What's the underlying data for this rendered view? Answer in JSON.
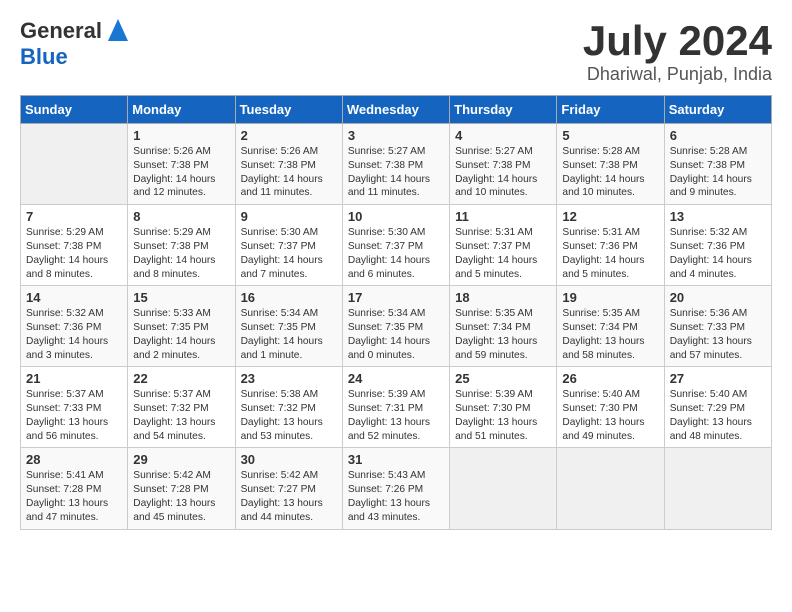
{
  "header": {
    "logo_general": "General",
    "logo_blue": "Blue",
    "month": "July 2024",
    "location": "Dhariwal, Punjab, India"
  },
  "weekdays": [
    "Sunday",
    "Monday",
    "Tuesday",
    "Wednesday",
    "Thursday",
    "Friday",
    "Saturday"
  ],
  "weeks": [
    [
      {
        "day": "",
        "info": ""
      },
      {
        "day": "1",
        "info": "Sunrise: 5:26 AM\nSunset: 7:38 PM\nDaylight: 14 hours\nand 12 minutes."
      },
      {
        "day": "2",
        "info": "Sunrise: 5:26 AM\nSunset: 7:38 PM\nDaylight: 14 hours\nand 11 minutes."
      },
      {
        "day": "3",
        "info": "Sunrise: 5:27 AM\nSunset: 7:38 PM\nDaylight: 14 hours\nand 11 minutes."
      },
      {
        "day": "4",
        "info": "Sunrise: 5:27 AM\nSunset: 7:38 PM\nDaylight: 14 hours\nand 10 minutes."
      },
      {
        "day": "5",
        "info": "Sunrise: 5:28 AM\nSunset: 7:38 PM\nDaylight: 14 hours\nand 10 minutes."
      },
      {
        "day": "6",
        "info": "Sunrise: 5:28 AM\nSunset: 7:38 PM\nDaylight: 14 hours\nand 9 minutes."
      }
    ],
    [
      {
        "day": "7",
        "info": "Sunrise: 5:29 AM\nSunset: 7:38 PM\nDaylight: 14 hours\nand 8 minutes."
      },
      {
        "day": "8",
        "info": "Sunrise: 5:29 AM\nSunset: 7:38 PM\nDaylight: 14 hours\nand 8 minutes."
      },
      {
        "day": "9",
        "info": "Sunrise: 5:30 AM\nSunset: 7:37 PM\nDaylight: 14 hours\nand 7 minutes."
      },
      {
        "day": "10",
        "info": "Sunrise: 5:30 AM\nSunset: 7:37 PM\nDaylight: 14 hours\nand 6 minutes."
      },
      {
        "day": "11",
        "info": "Sunrise: 5:31 AM\nSunset: 7:37 PM\nDaylight: 14 hours\nand 5 minutes."
      },
      {
        "day": "12",
        "info": "Sunrise: 5:31 AM\nSunset: 7:36 PM\nDaylight: 14 hours\nand 5 minutes."
      },
      {
        "day": "13",
        "info": "Sunrise: 5:32 AM\nSunset: 7:36 PM\nDaylight: 14 hours\nand 4 minutes."
      }
    ],
    [
      {
        "day": "14",
        "info": "Sunrise: 5:32 AM\nSunset: 7:36 PM\nDaylight: 14 hours\nand 3 minutes."
      },
      {
        "day": "15",
        "info": "Sunrise: 5:33 AM\nSunset: 7:35 PM\nDaylight: 14 hours\nand 2 minutes."
      },
      {
        "day": "16",
        "info": "Sunrise: 5:34 AM\nSunset: 7:35 PM\nDaylight: 14 hours\nand 1 minute."
      },
      {
        "day": "17",
        "info": "Sunrise: 5:34 AM\nSunset: 7:35 PM\nDaylight: 14 hours\nand 0 minutes."
      },
      {
        "day": "18",
        "info": "Sunrise: 5:35 AM\nSunset: 7:34 PM\nDaylight: 13 hours\nand 59 minutes."
      },
      {
        "day": "19",
        "info": "Sunrise: 5:35 AM\nSunset: 7:34 PM\nDaylight: 13 hours\nand 58 minutes."
      },
      {
        "day": "20",
        "info": "Sunrise: 5:36 AM\nSunset: 7:33 PM\nDaylight: 13 hours\nand 57 minutes."
      }
    ],
    [
      {
        "day": "21",
        "info": "Sunrise: 5:37 AM\nSunset: 7:33 PM\nDaylight: 13 hours\nand 56 minutes."
      },
      {
        "day": "22",
        "info": "Sunrise: 5:37 AM\nSunset: 7:32 PM\nDaylight: 13 hours\nand 54 minutes."
      },
      {
        "day": "23",
        "info": "Sunrise: 5:38 AM\nSunset: 7:32 PM\nDaylight: 13 hours\nand 53 minutes."
      },
      {
        "day": "24",
        "info": "Sunrise: 5:39 AM\nSunset: 7:31 PM\nDaylight: 13 hours\nand 52 minutes."
      },
      {
        "day": "25",
        "info": "Sunrise: 5:39 AM\nSunset: 7:30 PM\nDaylight: 13 hours\nand 51 minutes."
      },
      {
        "day": "26",
        "info": "Sunrise: 5:40 AM\nSunset: 7:30 PM\nDaylight: 13 hours\nand 49 minutes."
      },
      {
        "day": "27",
        "info": "Sunrise: 5:40 AM\nSunset: 7:29 PM\nDaylight: 13 hours\nand 48 minutes."
      }
    ],
    [
      {
        "day": "28",
        "info": "Sunrise: 5:41 AM\nSunset: 7:28 PM\nDaylight: 13 hours\nand 47 minutes."
      },
      {
        "day": "29",
        "info": "Sunrise: 5:42 AM\nSunset: 7:28 PM\nDaylight: 13 hours\nand 45 minutes."
      },
      {
        "day": "30",
        "info": "Sunrise: 5:42 AM\nSunset: 7:27 PM\nDaylight: 13 hours\nand 44 minutes."
      },
      {
        "day": "31",
        "info": "Sunrise: 5:43 AM\nSunset: 7:26 PM\nDaylight: 13 hours\nand 43 minutes."
      },
      {
        "day": "",
        "info": ""
      },
      {
        "day": "",
        "info": ""
      },
      {
        "day": "",
        "info": ""
      }
    ]
  ]
}
